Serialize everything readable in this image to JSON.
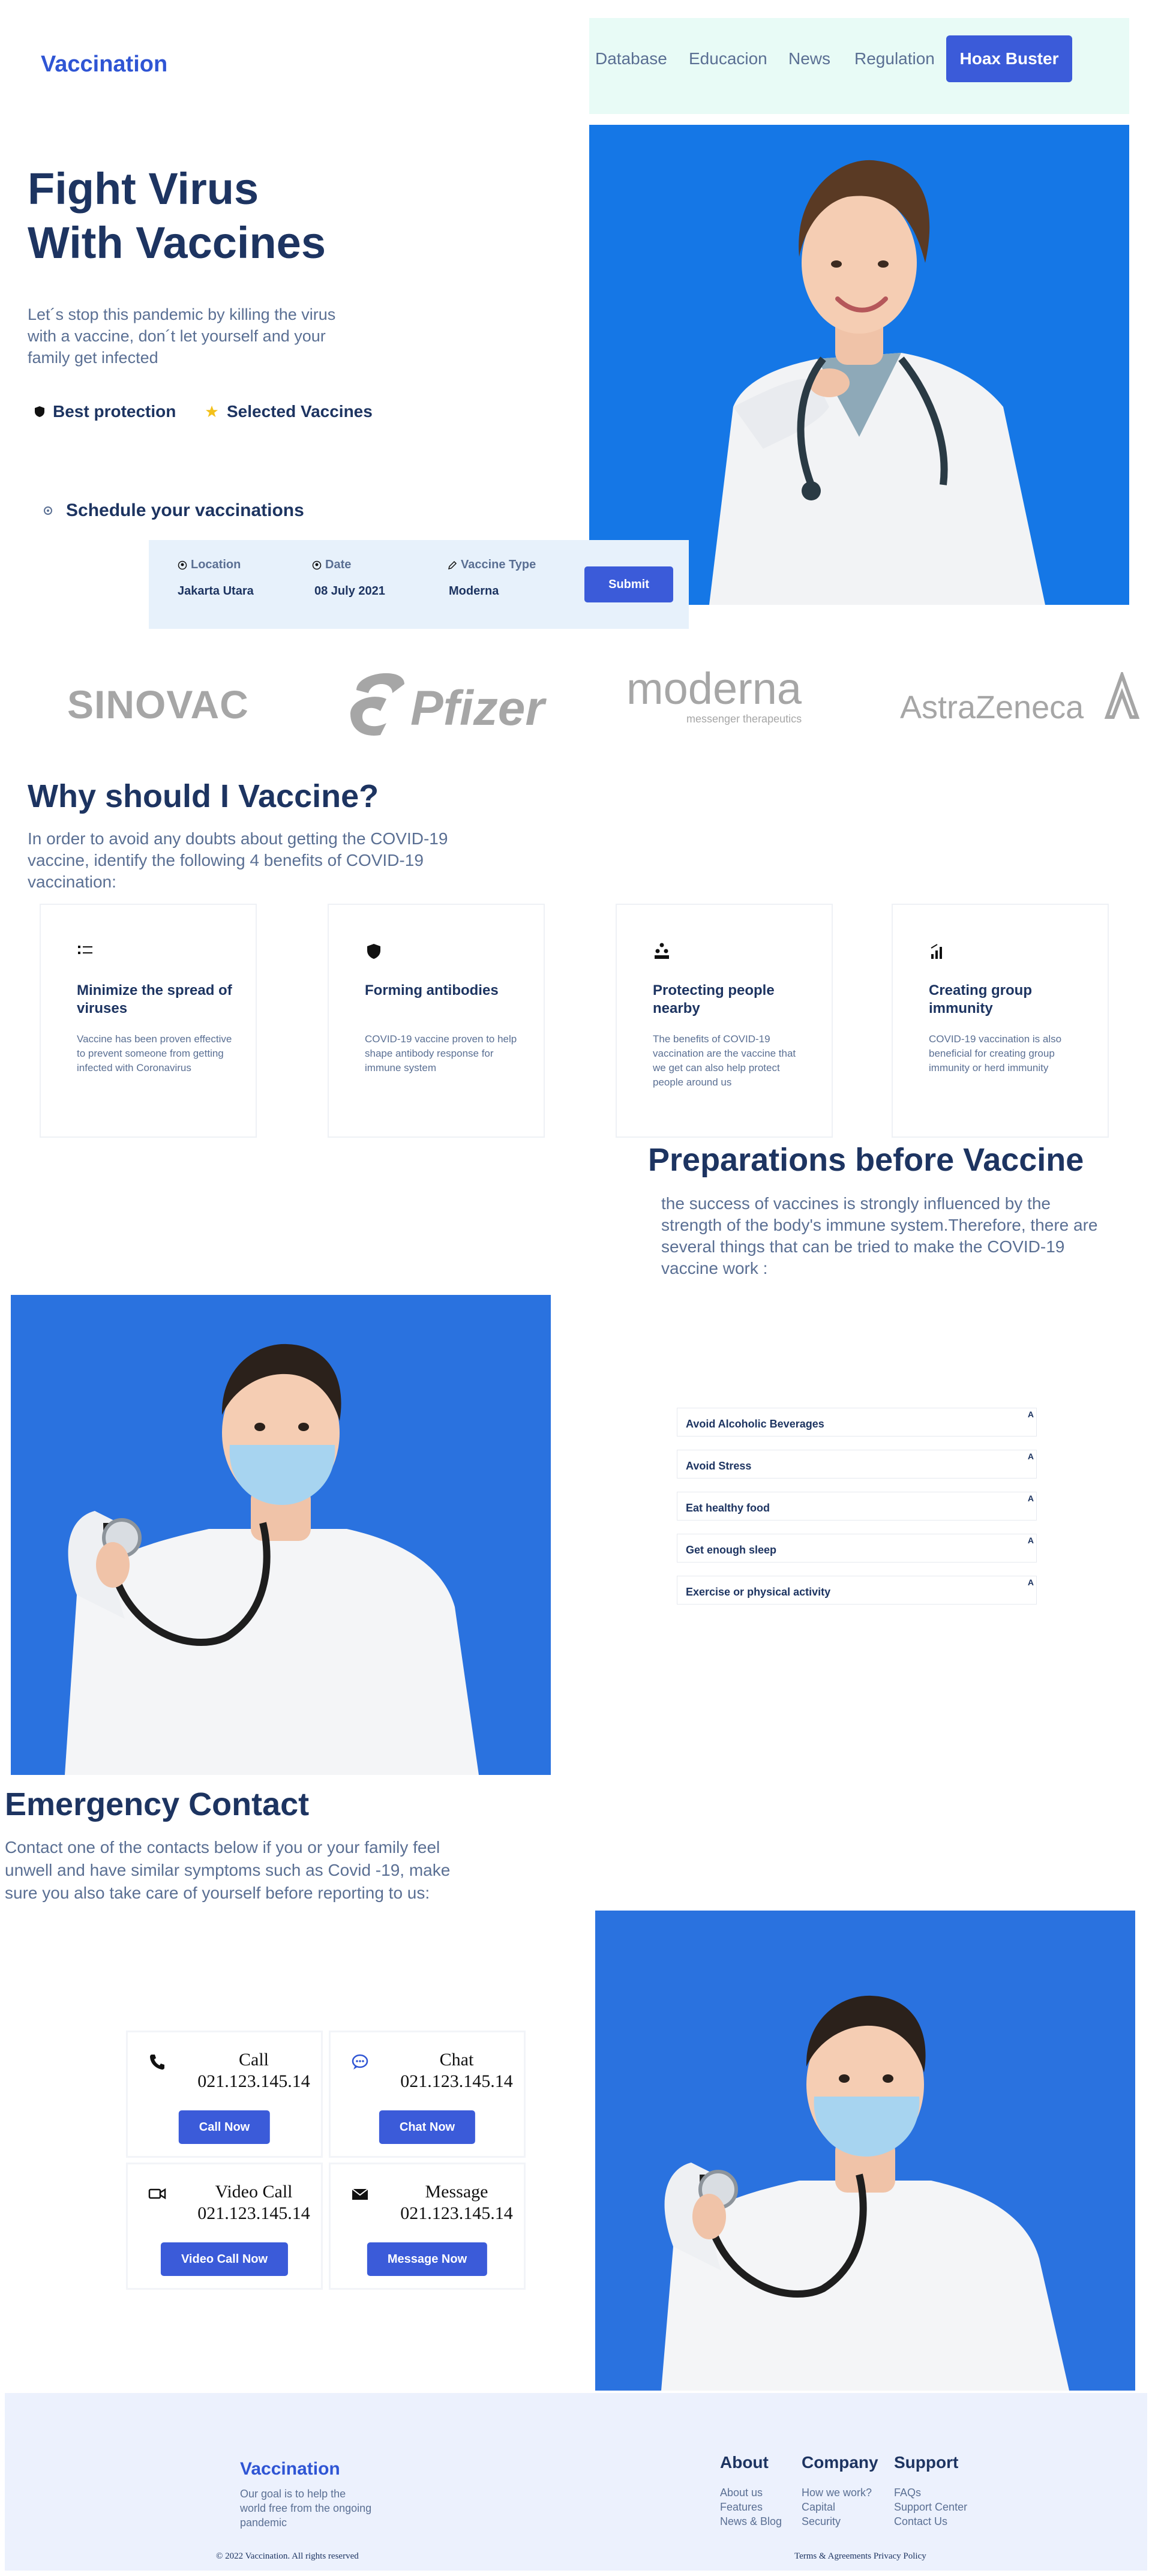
{
  "header": {
    "logo": "Vaccination",
    "nav": [
      "Database",
      "Educacion",
      "News",
      "Regulation"
    ],
    "cta": "Hoax Buster"
  },
  "hero": {
    "title_line1": "Fight Virus",
    "title_line2": "With Vaccines",
    "description": "Let´s stop this pandemic by killing the virus with a vaccine, don´t let yourself and your family get infected",
    "features": [
      "Best protection",
      "Selected Vaccines"
    ],
    "schedule_label": "Schedule your vaccinations"
  },
  "form": {
    "location_label": "Location",
    "location_value": "Jakarta Utara",
    "date_label": "Date",
    "date_value": "08 July 2021",
    "vaccine_label": "Vaccine Type",
    "vaccine_value": "Moderna",
    "submit": "Submit"
  },
  "brands": {
    "sinovac": "SINOVAC",
    "pfizer": "Pfizer",
    "moderna": "moderna",
    "moderna_sub": "messenger therapeutics",
    "astrazeneca": "AstraZeneca"
  },
  "why": {
    "title": "Why should I Vaccine?",
    "description": "In order to avoid any doubts about getting the COVID-19 vaccine, identify the following 4 benefits of COVID-19 vaccination:",
    "cards": [
      {
        "icon": "list-icon",
        "title": "Minimize the spread of viruses",
        "text": "Vaccine has been proven effective to prevent someone from getting infected with Coronavirus"
      },
      {
        "icon": "shield-icon",
        "title": "Forming antibodies",
        "text": "COVID-19 vaccine proven to help shape antibody response for immune system"
      },
      {
        "icon": "people-icon",
        "title": "Protecting people nearby",
        "text": "The benefits of COVID-19 vaccination are the vaccine that we get can also help protect people around us"
      },
      {
        "icon": "signal-icon",
        "title": "Creating group immunity",
        "text": "COVID-19 vaccination is also beneficial for creating group immunity or herd immunity"
      }
    ]
  },
  "preparations": {
    "title": "Preparations before Vaccine",
    "description": "the success of vaccines is strongly influenced by the strength of the body's immune system.Therefore, there are several things that can be tried to make the COVID-19 vaccine work :",
    "items": [
      "Avoid Alcoholic Beverages",
      "Avoid Stress",
      "Eat healthy food",
      "Get enough sleep",
      "Exercise or physical activity"
    ],
    "arrow": "A"
  },
  "emergency": {
    "title": "Emergency Contact",
    "description": "Contact one of the contacts below if you or your family feel unwell and have similar symptoms such as Covid -19, make sure you also take care of yourself before reporting to us:",
    "contacts": [
      {
        "icon": "phone-icon",
        "title": "Call",
        "number": "021.123.145.14",
        "button": "Call Now"
      },
      {
        "icon": "chat-icon",
        "title": "Chat",
        "number": "021.123.145.14",
        "button": "Chat Now"
      },
      {
        "icon": "video-icon",
        "title": "Video Call",
        "number": "021.123.145.14",
        "button": "Video Call Now"
      },
      {
        "icon": "mail-icon",
        "title": "Message",
        "number": "021.123.145.14",
        "button": "Message Now"
      }
    ]
  },
  "footer": {
    "logo": "Vaccination",
    "tagline": "Our goal is to help the world free from the ongoing pandemic",
    "about": {
      "title": "About",
      "links": [
        "About us",
        "Features",
        "News & Blog"
      ]
    },
    "company": {
      "title": "Company",
      "links": [
        "How we work?",
        "Capital",
        "Security"
      ]
    },
    "support": {
      "title": "Support",
      "links": [
        "FAQs",
        "Support Center",
        "Contact Us"
      ]
    },
    "copyright": "© 2022 Vaccination. All rights reserved",
    "legal": "Terms & Agreements Privacy Policy"
  },
  "colors": {
    "primary": "#3b5bd9",
    "navy": "#1d3461",
    "muted": "#5a6f93",
    "hero_blue": "#1577e6",
    "footer_bg": "#ecf1fd"
  }
}
